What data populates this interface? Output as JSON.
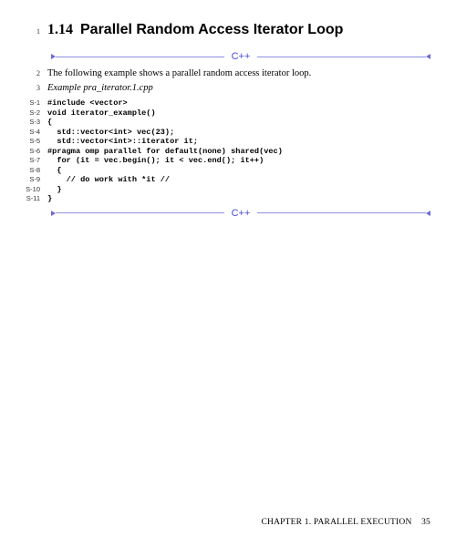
{
  "heading": {
    "line_num": "1",
    "section_num": "1.14",
    "title": "Parallel Random Access Iterator Loop"
  },
  "lang_divider": {
    "label": "C++"
  },
  "intro": {
    "line_num": "2",
    "text": "The following example shows a parallel random access iterator loop."
  },
  "example_caption": {
    "line_num": "3",
    "text": "Example pra_iterator.1.cpp"
  },
  "code": [
    {
      "n": "S-1",
      "t": "#include <vector>"
    },
    {
      "n": "S-2",
      "t": "void iterator_example()"
    },
    {
      "n": "S-3",
      "t": "{"
    },
    {
      "n": "S-4",
      "t": "  std::vector<int> vec(23);"
    },
    {
      "n": "S-5",
      "t": "  std::vector<int>::iterator it;"
    },
    {
      "n": "S-6",
      "t": "#pragma omp parallel for default(none) shared(vec)"
    },
    {
      "n": "S-7",
      "t": "  for (it = vec.begin(); it < vec.end(); it++)"
    },
    {
      "n": "S-8",
      "t": "  {"
    },
    {
      "n": "S-9",
      "t": "    // do work with *it //"
    },
    {
      "n": "S-10",
      "t": "  }"
    },
    {
      "n": "S-11",
      "t": "}"
    }
  ],
  "lang_divider_bottom": {
    "label": "C++"
  },
  "footer": {
    "chapter": "CHAPTER 1.  PARALLEL EXECUTION",
    "page": "35"
  }
}
